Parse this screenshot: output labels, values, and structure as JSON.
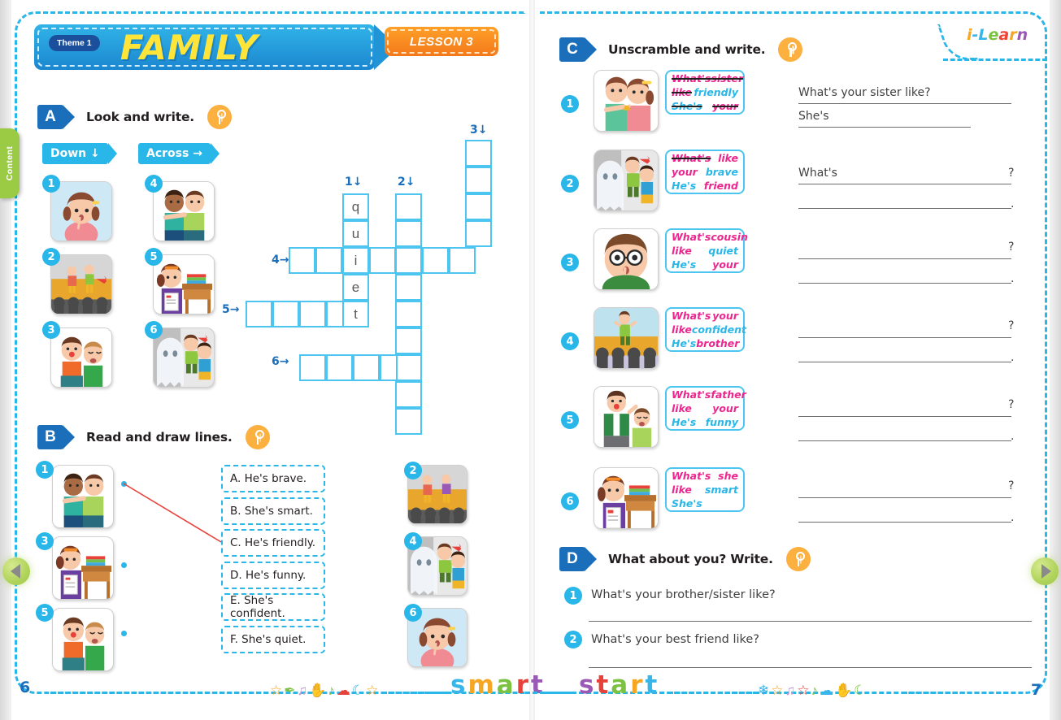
{
  "book": {
    "brand": "i-Learn",
    "brand_letters": [
      "i",
      "-",
      "L",
      "e",
      "a",
      "r",
      "n"
    ],
    "content_tab_label": "Content",
    "page_left": "6",
    "page_right": "7",
    "footer_word_left": "smart",
    "footer_word_right": "start"
  },
  "header": {
    "theme_label": "Theme 1",
    "title": "FAMILY",
    "lesson": "LESSON 3"
  },
  "nav": {
    "prev_label": "Previous page",
    "next_label": "Next page"
  },
  "sectionA": {
    "letter": "A",
    "title": "Look and write.",
    "down_label": "Down",
    "across_label": "Across",
    "down_items": [
      "1",
      "2",
      "3"
    ],
    "across_items": [
      "4",
      "5",
      "6"
    ],
    "clue_labels": [
      "1",
      "2",
      "3",
      "4",
      "5",
      "6"
    ],
    "prefilled": {
      "word": "quiet",
      "letters": [
        "q",
        "u",
        "i",
        "e",
        "t"
      ]
    }
  },
  "sectionB": {
    "letter": "B",
    "title": "Read and draw lines.",
    "options": [
      "A. He's brave.",
      "B. She's smart.",
      "C. He's friendly.",
      "D. He's funny.",
      "E. She's confident.",
      "F. She's quiet."
    ],
    "left_numbers": [
      "1",
      "3",
      "5"
    ],
    "right_numbers": [
      "2",
      "4",
      "6"
    ],
    "drawn_line": {
      "from": "1",
      "to": "C"
    }
  },
  "sectionC": {
    "letter": "C",
    "title": "Unscramble and write.",
    "items": [
      {
        "number": "1",
        "words": [
          {
            "text": "What's",
            "color": "pink",
            "struck": true
          },
          {
            "text": "sister",
            "color": "pink",
            "struck": true
          },
          {
            "text": "like",
            "color": "pink",
            "struck": true
          },
          {
            "text": "friendly",
            "color": "blue",
            "struck": false
          },
          {
            "text": "She's",
            "color": "blue",
            "struck": true
          },
          {
            "text": "your",
            "color": "pink",
            "struck": true
          }
        ],
        "answer_line1": "What's your sister like?",
        "answer_line2": "She's",
        "line1_suffix": "",
        "line2_suffix": ""
      },
      {
        "number": "2",
        "words": [
          {
            "text": "What's",
            "color": "pink",
            "struck": true
          },
          {
            "text": "like",
            "color": "pink",
            "struck": false
          },
          {
            "text": "your",
            "color": "pink",
            "struck": false
          },
          {
            "text": "brave",
            "color": "blue",
            "struck": false
          },
          {
            "text": "He's",
            "color": "blue",
            "struck": false
          },
          {
            "text": "friend",
            "color": "pink",
            "struck": false
          }
        ],
        "answer_line1": "What's",
        "answer_line2": "",
        "line1_suffix": "?",
        "line2_suffix": "."
      },
      {
        "number": "3",
        "words": [
          {
            "text": "What's",
            "color": "pink",
            "struck": false
          },
          {
            "text": "cousin",
            "color": "pink",
            "struck": false
          },
          {
            "text": "like",
            "color": "pink",
            "struck": false
          },
          {
            "text": "quiet",
            "color": "blue",
            "struck": false
          },
          {
            "text": "He's",
            "color": "blue",
            "struck": false
          },
          {
            "text": "your",
            "color": "pink",
            "struck": false
          }
        ],
        "answer_line1": "",
        "answer_line2": "",
        "line1_suffix": "?",
        "line2_suffix": "."
      },
      {
        "number": "4",
        "words": [
          {
            "text": "What's",
            "color": "pink",
            "struck": false
          },
          {
            "text": "your",
            "color": "pink",
            "struck": false
          },
          {
            "text": "like",
            "color": "pink",
            "struck": false
          },
          {
            "text": "confident",
            "color": "blue",
            "struck": false
          },
          {
            "text": "He's",
            "color": "blue",
            "struck": false
          },
          {
            "text": "brother",
            "color": "pink",
            "struck": false
          }
        ],
        "answer_line1": "",
        "answer_line2": "",
        "line1_suffix": "?",
        "line2_suffix": "."
      },
      {
        "number": "5",
        "words": [
          {
            "text": "What's",
            "color": "pink",
            "struck": false
          },
          {
            "text": "father",
            "color": "pink",
            "struck": false
          },
          {
            "text": "like",
            "color": "pink",
            "struck": false
          },
          {
            "text": "your",
            "color": "pink",
            "struck": false
          },
          {
            "text": "He's",
            "color": "blue",
            "struck": false
          },
          {
            "text": "funny",
            "color": "blue",
            "struck": false
          }
        ],
        "answer_line1": "",
        "answer_line2": "",
        "line1_suffix": "?",
        "line2_suffix": "."
      },
      {
        "number": "6",
        "words": [
          {
            "text": "What's",
            "color": "pink",
            "struck": false
          },
          {
            "text": "she",
            "color": "pink",
            "struck": false
          },
          {
            "text": "like",
            "color": "pink",
            "struck": false
          },
          {
            "text": "smart",
            "color": "blue",
            "struck": false
          },
          {
            "text": "She's",
            "color": "blue",
            "struck": false
          },
          {
            "text": "",
            "color": "pink",
            "struck": false
          }
        ],
        "answer_line1": "",
        "answer_line2": "",
        "line1_suffix": "?",
        "line2_suffix": "."
      }
    ]
  },
  "sectionD": {
    "letter": "D",
    "title": "What about you? Write.",
    "questions": [
      {
        "number": "1",
        "text": "What's your brother/sister like?"
      },
      {
        "number": "2",
        "text": "What's your best friend like?"
      }
    ]
  },
  "colors": {
    "sky": "#29b6e8",
    "deep_blue": "#1b6fba",
    "orange": "#f3781b",
    "pink": "#ec268f",
    "yellow": "#ffe53a",
    "green": "#9bcb45"
  }
}
